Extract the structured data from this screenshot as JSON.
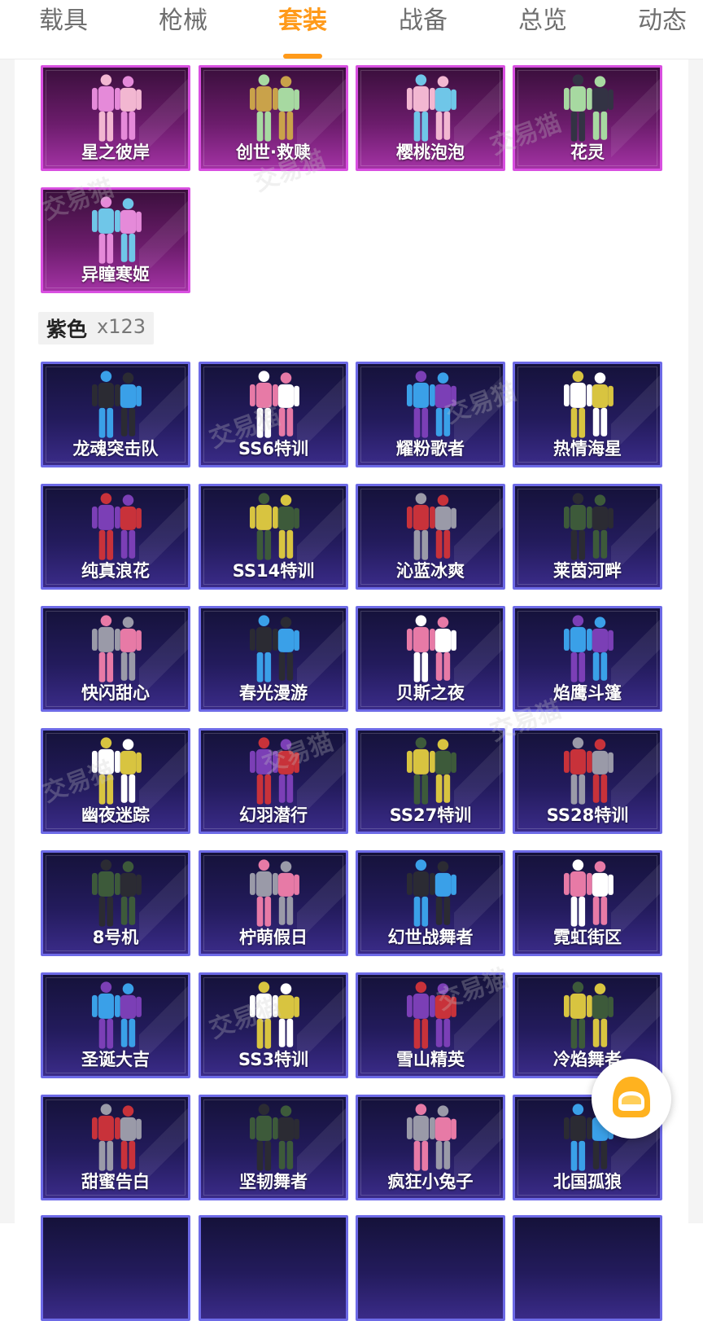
{
  "tabs": [
    {
      "label": "载具"
    },
    {
      "label": "枪械"
    },
    {
      "label": "套装"
    },
    {
      "label": "战备"
    },
    {
      "label": "总览"
    },
    {
      "label": "动态"
    }
  ],
  "active_tab": "套装",
  "accent_color": "#ff9a1a",
  "legend_skins": [
    {
      "name": "星之彼岸"
    },
    {
      "name": "创世·救赎"
    },
    {
      "name": "樱桃泡泡"
    },
    {
      "name": "花灵"
    },
    {
      "name": "异瞳寒姬"
    }
  ],
  "purple_section": {
    "name": "紫色",
    "count": "x123"
  },
  "purple_skins": [
    {
      "name": "龙魂突击队"
    },
    {
      "name": "SS6特训"
    },
    {
      "name": "耀粉歌者"
    },
    {
      "name": "热情海星"
    },
    {
      "name": "纯真浪花"
    },
    {
      "name": "SS14特训"
    },
    {
      "name": "沁蓝冰爽"
    },
    {
      "name": "莱茵河畔"
    },
    {
      "name": "快闪甜心"
    },
    {
      "name": "春光漫游"
    },
    {
      "name": "贝斯之夜"
    },
    {
      "name": "焰鹰斗篷"
    },
    {
      "name": "幽夜迷踪"
    },
    {
      "name": "幻羽潜行"
    },
    {
      "name": "SS27特训"
    },
    {
      "name": "SS28特训"
    },
    {
      "name": "8号机"
    },
    {
      "name": "柠萌假日"
    },
    {
      "name": "幻世战舞者"
    },
    {
      "name": "霓虹街区"
    },
    {
      "name": "圣诞大吉"
    },
    {
      "name": "SS3特训"
    },
    {
      "name": "雪山精英"
    },
    {
      "name": "冷焰舞者"
    },
    {
      "name": "甜蜜告白"
    },
    {
      "name": "坚韧舞者"
    },
    {
      "name": "疯狂小兔子"
    },
    {
      "name": "北国孤狼"
    }
  ],
  "watermark_text": "交易猫",
  "fab_icon": "gold-helmet-icon"
}
